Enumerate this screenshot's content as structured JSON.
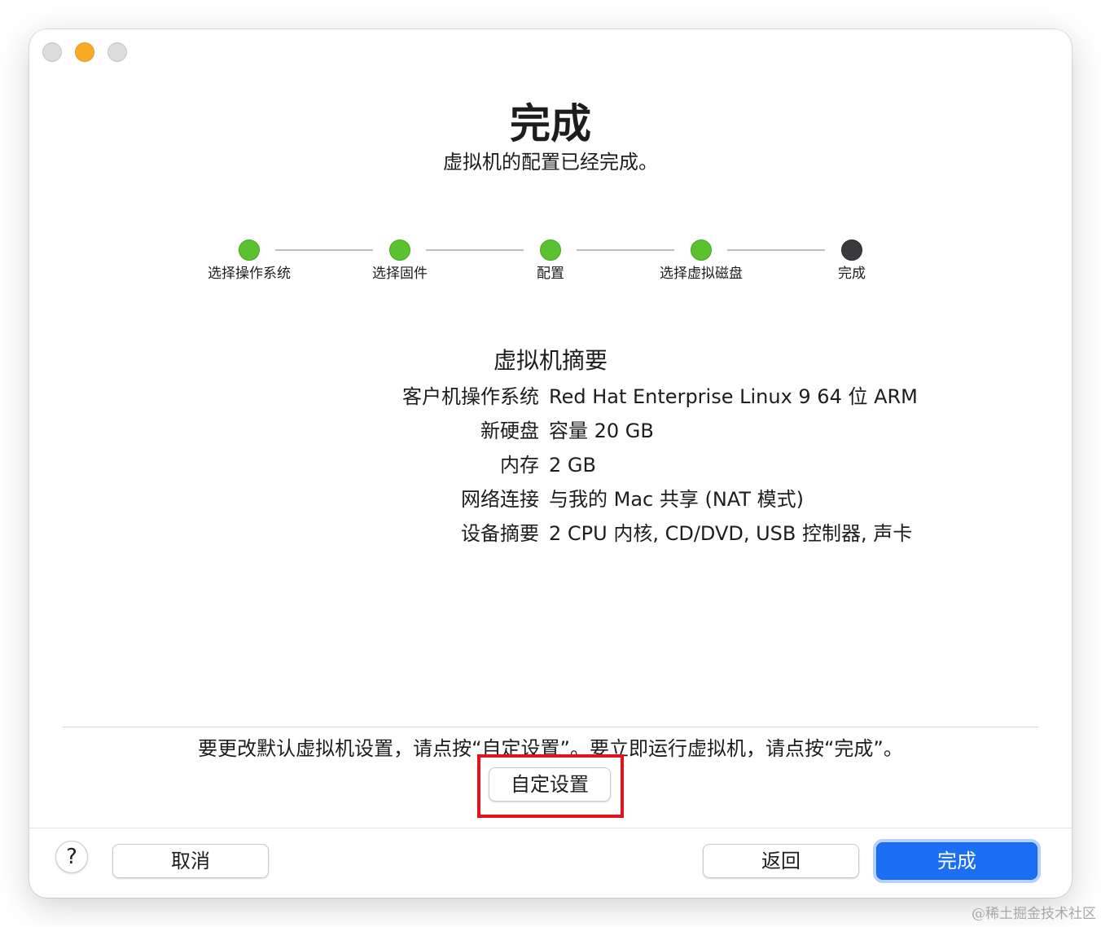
{
  "header": {
    "title": "完成",
    "subtitle": "虚拟机的配置已经完成。"
  },
  "steps": [
    {
      "label": "选择操作系统",
      "state": "done"
    },
    {
      "label": "选择固件",
      "state": "done"
    },
    {
      "label": "配置",
      "state": "done"
    },
    {
      "label": "选择虚拟磁盘",
      "state": "done"
    },
    {
      "label": "完成",
      "state": "current"
    }
  ],
  "summary": {
    "title": "虚拟机摘要",
    "rows": [
      {
        "label": "客户机操作系统",
        "value": "Red Hat Enterprise Linux 9 64 位 ARM"
      },
      {
        "label": "新硬盘",
        "value": "容量 20 GB"
      },
      {
        "label": "内存",
        "value": "2 GB"
      },
      {
        "label": "网络连接",
        "value": "与我的 Mac 共享 (NAT 模式)"
      },
      {
        "label": "设备摘要",
        "value": "2 CPU 内核, CD/DVD, USB 控制器, 声卡"
      }
    ]
  },
  "footer": {
    "hint": "要更改默认虚拟机设置，请点按“自定设置”。要立即运行虚拟机，请点按“完成”。",
    "customize_label": "自定设置",
    "help_label": "?",
    "cancel_label": "取消",
    "back_label": "返回",
    "done_label": "完成"
  },
  "watermark": "@稀土掘金技术社区",
  "colors": {
    "step_done": "#5ac12f",
    "step_current": "#3a3a3c",
    "primary_button": "#1c6ef2",
    "highlight": "#e3131e"
  }
}
